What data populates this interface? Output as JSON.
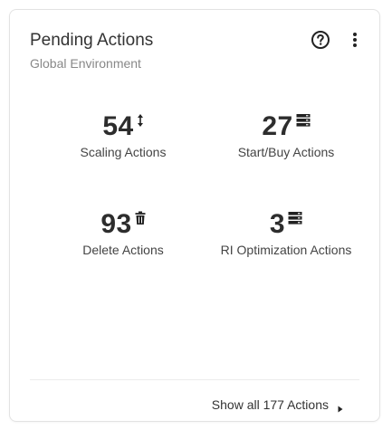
{
  "card": {
    "title": "Pending Actions",
    "subtitle": "Global Environment",
    "help_icon": "help-circle-icon",
    "menu_icon": "kebab-menu-icon"
  },
  "metrics": [
    {
      "value": "54",
      "label": "Scaling Actions",
      "icon": "scale-arrows-icon"
    },
    {
      "value": "27",
      "label": "Start/Buy Actions",
      "icon": "server-stack-icon"
    },
    {
      "value": "93",
      "label": "Delete Actions",
      "icon": "trash-icon"
    },
    {
      "value": "3",
      "label": "RI Optimization Actions",
      "icon": "server-stack-icon"
    }
  ],
  "footer": {
    "link_label": "Show all 177 Actions",
    "icon": "caret-right-icon"
  },
  "colors": {
    "text_primary": "#2d2d2d",
    "text_secondary": "#888888",
    "border": "#e3e3e3"
  }
}
